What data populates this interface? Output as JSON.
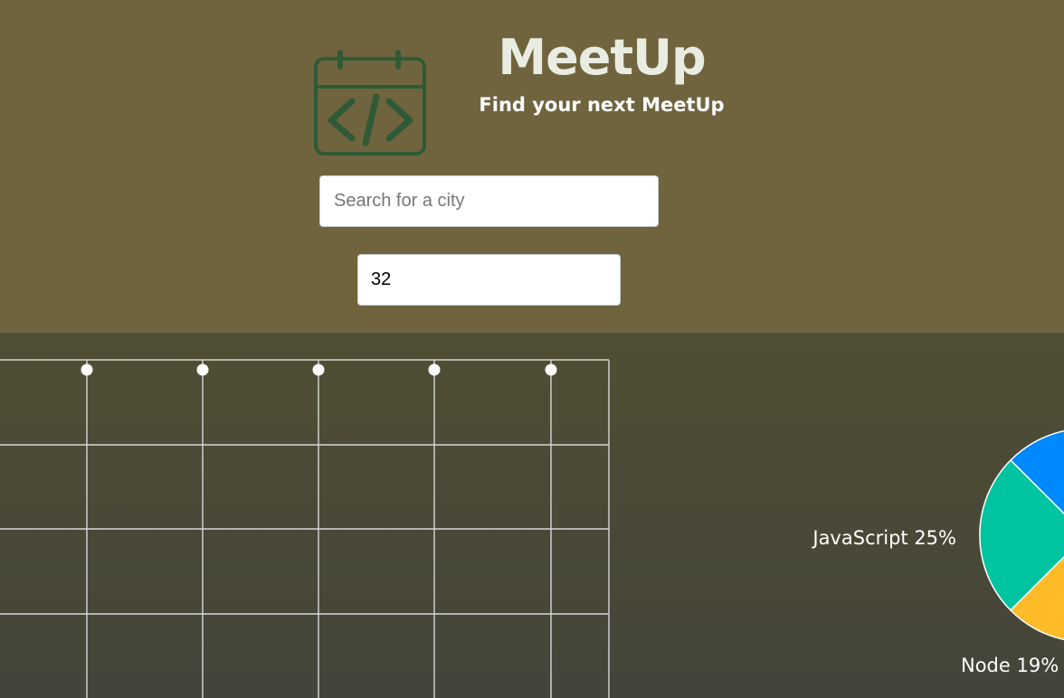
{
  "header": {
    "title": "MeetUp",
    "subtitle": "Find your next MeetUp",
    "logo_icon": "calendar-code-icon",
    "background": "#70643f",
    "logo_color": "#2f5a36"
  },
  "city_search": {
    "value": "",
    "placeholder": "Search for a city"
  },
  "number_of_events": {
    "value": "32"
  },
  "colors": {
    "section_background": "#4c4a36",
    "grid": "#d8d8d8",
    "scatter_point": "#ffffff",
    "pie_blue": "#0088fe",
    "pie_green": "#00c49f",
    "pie_yellow": "#ffbb28"
  },
  "chart_data": [
    {
      "type": "scatter",
      "points": 5,
      "grid": true
    },
    {
      "type": "pie",
      "slices": [
        {
          "name": "JavaScript",
          "percent": 25,
          "label": "JavaScript 25%",
          "color": "#00c49f"
        },
        {
          "name": "Node",
          "percent": 19,
          "label": "Node 19%",
          "color": "#ffbb28"
        },
        {
          "color": "#0088fe"
        }
      ]
    }
  ]
}
